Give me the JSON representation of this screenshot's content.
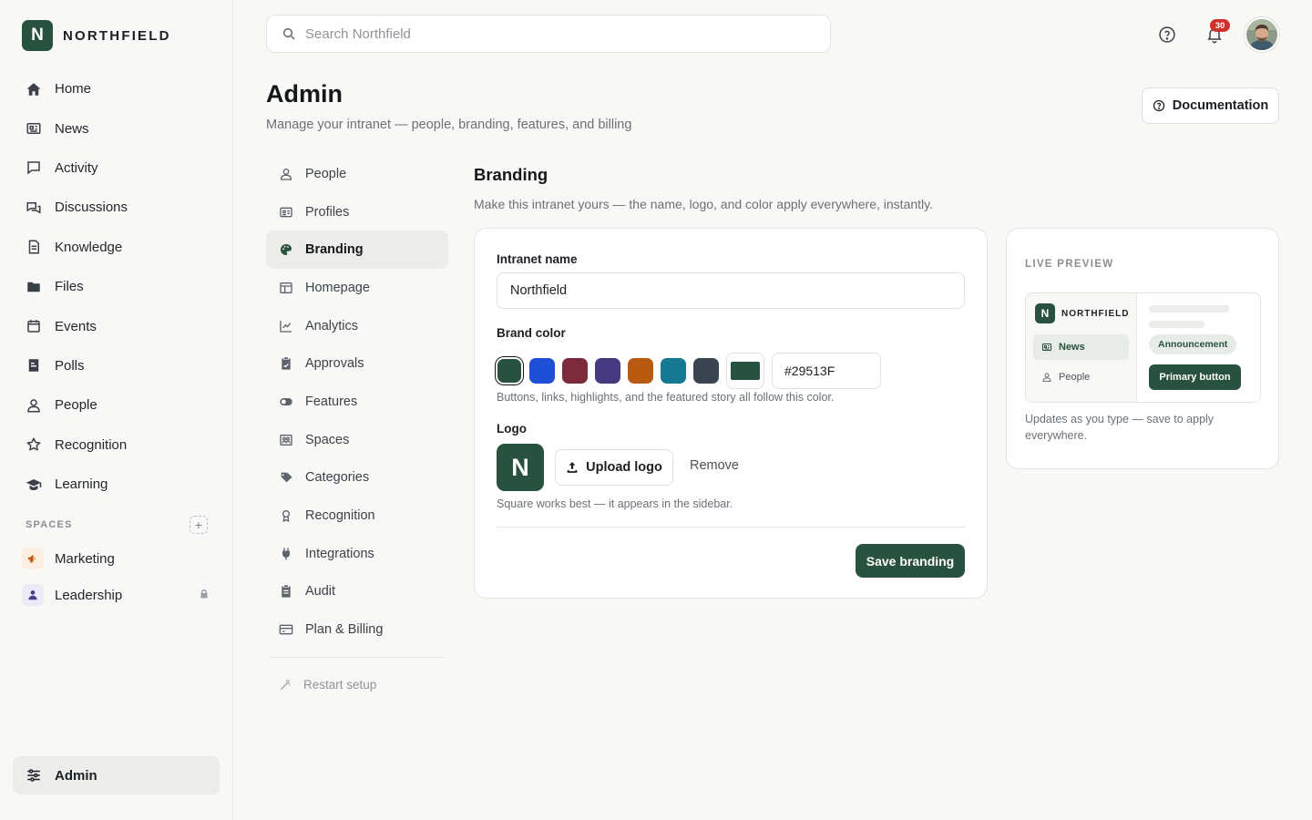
{
  "brand": {
    "initial": "N",
    "name": "NORTHFIELD",
    "color": "#29513F"
  },
  "sidebar": {
    "items": [
      {
        "label": "Home",
        "icon": "home-icon"
      },
      {
        "label": "News",
        "icon": "newspaper-icon"
      },
      {
        "label": "Activity",
        "icon": "message-square-icon"
      },
      {
        "label": "Discussions",
        "icon": "chat-bubbles-icon"
      },
      {
        "label": "Knowledge",
        "icon": "document-icon"
      },
      {
        "label": "Files",
        "icon": "folder-icon"
      },
      {
        "label": "Events",
        "icon": "calendar-icon"
      },
      {
        "label": "Polls",
        "icon": "poll-icon"
      },
      {
        "label": "People",
        "icon": "user-icon"
      },
      {
        "label": "Recognition",
        "icon": "star-icon"
      },
      {
        "label": "Learning",
        "icon": "graduation-cap-icon"
      }
    ],
    "spaces_title": "SPACES",
    "spaces": [
      {
        "label": "Marketing",
        "icon": "megaphone-icon",
        "badge_bg": "#fdeee2",
        "icon_color": "#c4570f"
      },
      {
        "label": "Leadership",
        "icon": "person-icon",
        "badge_bg": "#eceaf6",
        "icon_color": "#4b3f8a",
        "locked": true
      }
    ],
    "admin_label": "Admin"
  },
  "topbar": {
    "search_placeholder": "Search Northfield",
    "notification_count": "30"
  },
  "header": {
    "title": "Admin",
    "subtitle": "Manage your intranet — people, branding, features, and billing",
    "doc_button": "Documentation"
  },
  "admin_nav": {
    "items": [
      {
        "label": "People",
        "icon": "user-icon"
      },
      {
        "label": "Profiles",
        "icon": "id-card-icon"
      },
      {
        "label": "Branding",
        "icon": "palette-icon",
        "active": true
      },
      {
        "label": "Homepage",
        "icon": "layout-icon"
      },
      {
        "label": "Analytics",
        "icon": "line-chart-icon"
      },
      {
        "label": "Approvals",
        "icon": "clipboard-check-icon"
      },
      {
        "label": "Features",
        "icon": "toggle-icon"
      },
      {
        "label": "Spaces",
        "icon": "spaces-icon"
      },
      {
        "label": "Categories",
        "icon": "tags-icon"
      },
      {
        "label": "Recognition",
        "icon": "award-icon"
      },
      {
        "label": "Integrations",
        "icon": "plug-icon"
      },
      {
        "label": "Audit",
        "icon": "clipboard-list-icon"
      },
      {
        "label": "Plan & Billing",
        "icon": "credit-card-icon"
      }
    ],
    "restart_label": "Restart setup"
  },
  "branding": {
    "title": "Branding",
    "subtitle": "Make this intranet yours — the name, logo, and color apply everywhere, instantly.",
    "name_label": "Intranet name",
    "name_value": "Northfield",
    "color_label": "Brand color",
    "swatches": [
      "#29513F",
      "#1f4fd6",
      "#7d2a3d",
      "#46397f",
      "#b85a10",
      "#157a91",
      "#3a4350"
    ],
    "selected_color": "#29513F",
    "hex_value": "#29513F",
    "color_help": "Buttons, links, highlights, and the featured story all follow this color.",
    "logo_label": "Logo",
    "logo_initial": "N",
    "upload_label": "Upload logo",
    "remove_label": "Remove",
    "logo_help": "Square works best — it appears in the sidebar.",
    "save_label": "Save branding"
  },
  "preview": {
    "title": "LIVE PREVIEW",
    "brand_initial": "N",
    "brand_name": "NORTHFIELD",
    "nav_items": [
      "News",
      "People"
    ],
    "chip_label": "Announcement",
    "button_label": "Primary button",
    "note": "Updates as you type — save to apply everywhere."
  }
}
